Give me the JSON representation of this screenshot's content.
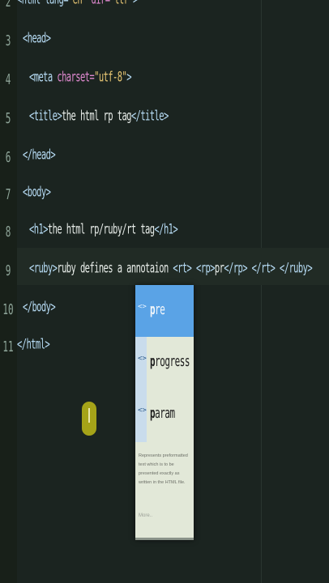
{
  "editor": {
    "lines": [
      {
        "num": "2",
        "tokens": [
          {
            "t": "<html lang=",
            "c": "tag"
          },
          {
            "t": "\"en\"",
            "c": "str"
          },
          {
            "t": " dir=",
            "c": "attr"
          },
          {
            "t": "\"ltr\"",
            "c": "str"
          },
          {
            "t": ">",
            "c": "tag"
          }
        ]
      },
      {
        "num": "3",
        "tokens": [
          {
            "t": "<head>",
            "c": "tag"
          }
        ]
      },
      {
        "num": "4",
        "tokens": [
          {
            "t": "<meta ",
            "c": "tag"
          },
          {
            "t": "charset=",
            "c": "attr"
          },
          {
            "t": "\"utf-8\"",
            "c": "str"
          },
          {
            "t": ">",
            "c": "tag"
          }
        ]
      },
      {
        "num": "5",
        "tokens": [
          {
            "t": "<title>",
            "c": "tag"
          },
          {
            "t": "the html rp tag",
            "c": "txt"
          },
          {
            "t": "</title>",
            "c": "tag"
          }
        ]
      },
      {
        "num": "6",
        "tokens": [
          {
            "t": "</head>",
            "c": "tag"
          }
        ]
      },
      {
        "num": "7",
        "tokens": [
          {
            "t": "<body>",
            "c": "tag"
          }
        ]
      },
      {
        "num": "8",
        "tokens": [
          {
            "t": "<h1>",
            "c": "tag"
          },
          {
            "t": "the html rp/ruby/rt tag",
            "c": "txt"
          },
          {
            "t": "</h1>",
            "c": "tag"
          }
        ]
      },
      {
        "num": "9",
        "tokens": [
          {
            "t": "<ruby>",
            "c": "tag"
          },
          {
            "t": "ruby defines a annotaion ",
            "c": "txt"
          },
          {
            "t": "<rt> <rp>",
            "c": "tag"
          },
          {
            "t": "pr",
            "c": "txt"
          },
          {
            "t": "</rp> </rt> </ruby>",
            "c": "tag"
          }
        ]
      },
      {
        "num": "10",
        "tokens": [
          {
            "t": "</body>",
            "c": "tag"
          }
        ]
      },
      {
        "num": "11",
        "tokens": [
          {
            "t": "</html>",
            "c": "tag"
          }
        ]
      }
    ]
  },
  "autocomplete": {
    "items": [
      {
        "icon": "<>",
        "match": "p",
        "rest": "re",
        "selected": true
      },
      {
        "icon": "<>",
        "match": "p",
        "rest": "rogress",
        "selected": false
      },
      {
        "icon": "<>",
        "match": "p",
        "rest": "aram",
        "selected": false
      }
    ],
    "description": "Represents preformatted text which is to be presented exactly as written in the HTML file.",
    "more_label": "More.."
  }
}
